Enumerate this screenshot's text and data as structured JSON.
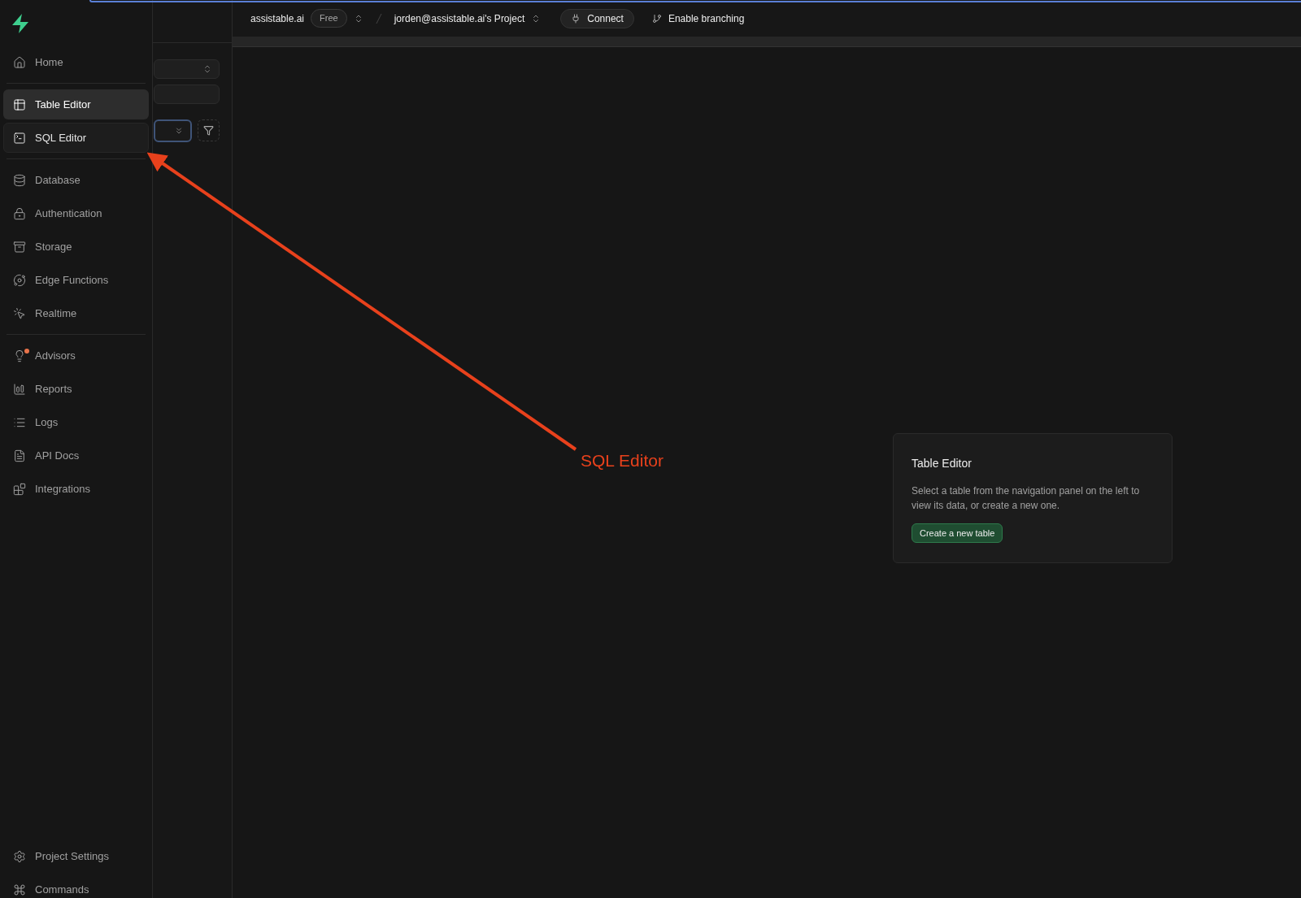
{
  "top_bar": {
    "org": "assistable.ai",
    "plan": "Free",
    "project": "jorden@assistable.ai's Project",
    "connect": "Connect",
    "branching": "Enable branching"
  },
  "sidebar": {
    "groups": [
      [
        {
          "label": "Home",
          "selected": false,
          "hovered": false
        }
      ],
      [
        {
          "label": "Table Editor",
          "selected": true,
          "hovered": false
        },
        {
          "label": "SQL Editor",
          "selected": false,
          "hovered": true
        }
      ],
      [
        {
          "label": "Database",
          "selected": false,
          "hovered": false
        },
        {
          "label": "Authentication",
          "selected": false,
          "hovered": false
        },
        {
          "label": "Storage",
          "selected": false,
          "hovered": false
        },
        {
          "label": "Edge Functions",
          "selected": false,
          "hovered": false
        },
        {
          "label": "Realtime",
          "selected": false,
          "hovered": false
        }
      ],
      [
        {
          "label": "Advisors",
          "selected": false,
          "hovered": false,
          "notification": true
        },
        {
          "label": "Reports",
          "selected": false,
          "hovered": false
        },
        {
          "label": "Logs",
          "selected": false,
          "hovered": false
        },
        {
          "label": "API Docs",
          "selected": false,
          "hovered": false
        },
        {
          "label": "Integrations",
          "selected": false,
          "hovered": false
        }
      ]
    ],
    "footer": [
      {
        "label": "Project Settings",
        "selected": false,
        "hovered": false
      },
      {
        "label": "Commands",
        "selected": false,
        "hovered": false
      }
    ]
  },
  "card": {
    "title": "Table Editor",
    "description": "Select a table from the navigation panel on the left to view its data, or create a new one.",
    "button": "Create a new table"
  },
  "annotation": {
    "label": "SQL Editor"
  }
}
